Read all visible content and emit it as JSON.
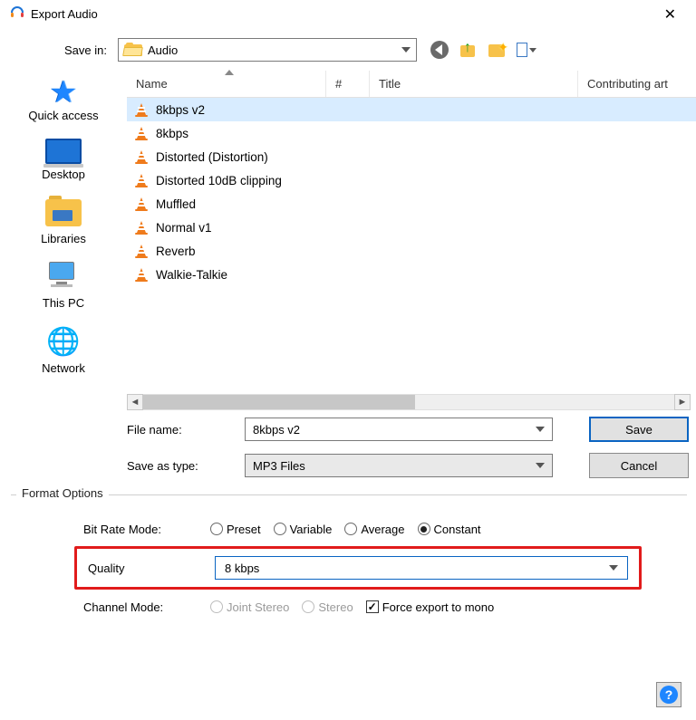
{
  "window": {
    "title": "Export Audio"
  },
  "saveIn": {
    "label": "Save in:",
    "folder": "Audio"
  },
  "places": {
    "quickAccess": "Quick access",
    "desktop": "Desktop",
    "libraries": "Libraries",
    "thisPc": "This PC",
    "network": "Network"
  },
  "columns": {
    "name": "Name",
    "num": "#",
    "title": "Title",
    "contrib": "Contributing art"
  },
  "files": {
    "items": [
      {
        "name": "8kbps v2"
      },
      {
        "name": "8kbps"
      },
      {
        "name": "Distorted (Distortion)"
      },
      {
        "name": "Distorted 10dB clipping"
      },
      {
        "name": "Muffled"
      },
      {
        "name": "Normal v1"
      },
      {
        "name": "Reverb"
      },
      {
        "name": "Walkie-Talkie"
      }
    ]
  },
  "fileName": {
    "label": "File name:",
    "value": "8kbps v2"
  },
  "saveType": {
    "label": "Save as type:",
    "value": "MP3 Files"
  },
  "buttons": {
    "save": "Save",
    "cancel": "Cancel"
  },
  "format": {
    "legend": "Format Options",
    "bitRate": {
      "label": "Bit Rate Mode:",
      "preset": "Preset",
      "variable": "Variable",
      "average": "Average",
      "constant": "Constant",
      "selected": "constant"
    },
    "quality": {
      "label": "Quality",
      "value": "8 kbps"
    },
    "channel": {
      "label": "Channel Mode:",
      "joint": "Joint Stereo",
      "stereo": "Stereo",
      "forceMono": "Force export to mono"
    }
  }
}
